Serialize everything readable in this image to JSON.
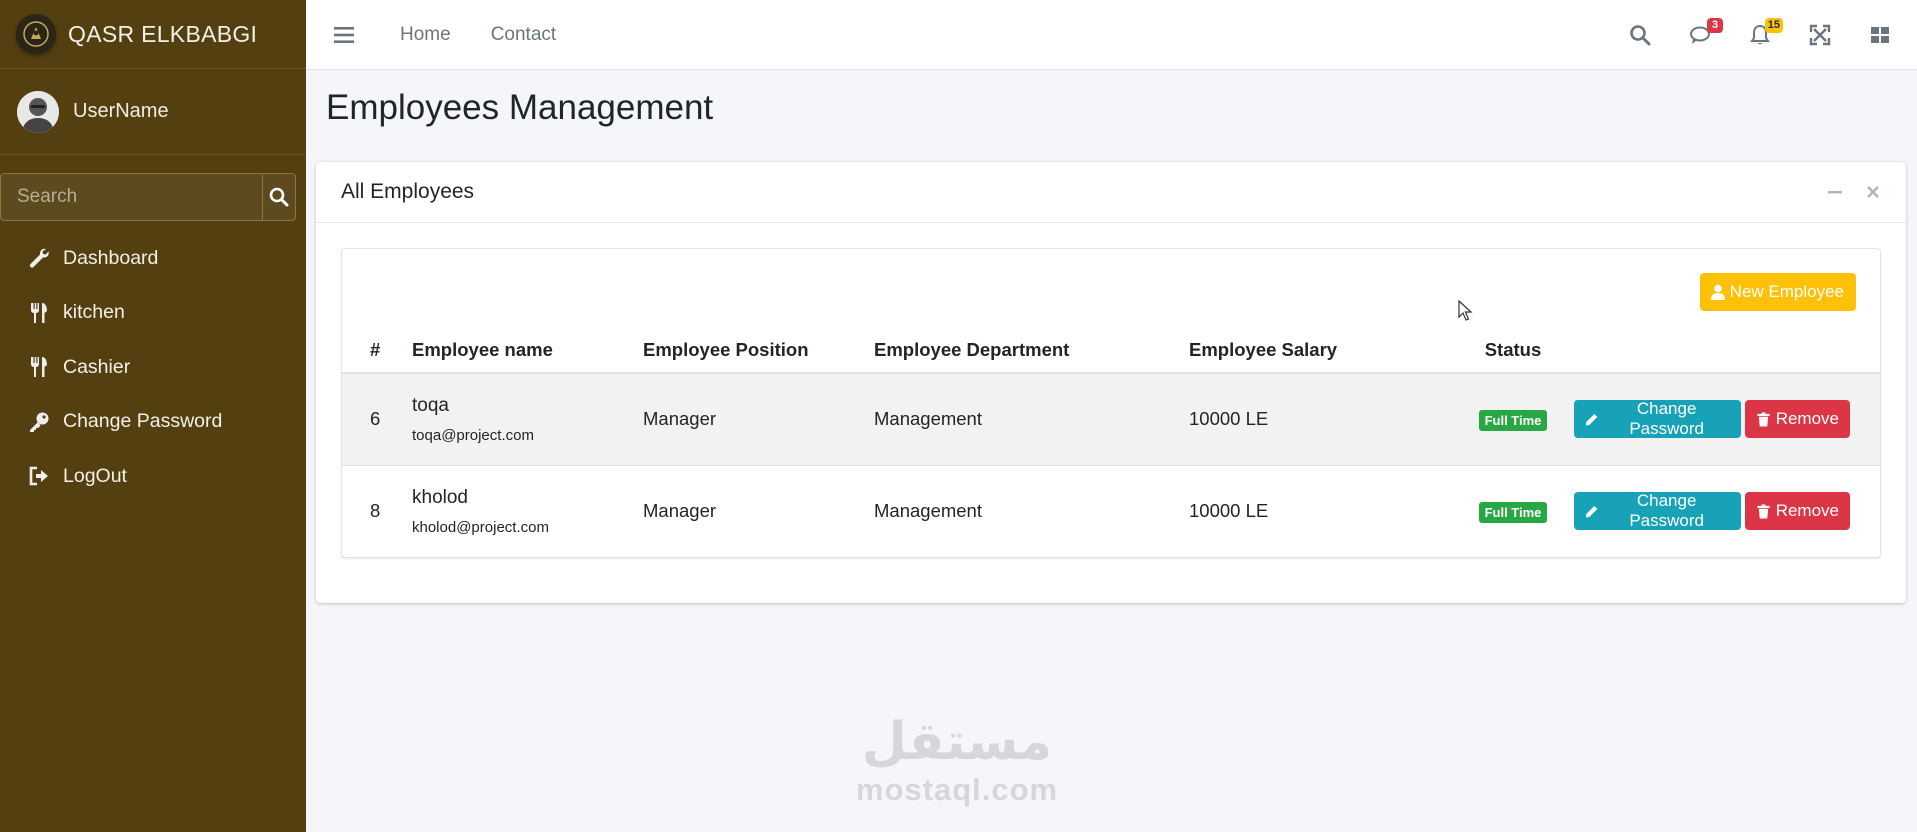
{
  "brand": {
    "name": "QASR ELKBABGI",
    "logo_icon": "crest-icon"
  },
  "user": {
    "name": "UserName"
  },
  "sidebar": {
    "search_placeholder": "Search",
    "items": [
      {
        "label": "Dashboard",
        "icon": "wrench-icon"
      },
      {
        "label": "kitchen",
        "icon": "utensils-icon"
      },
      {
        "label": "Cashier",
        "icon": "utensils-icon"
      },
      {
        "label": "Change Password",
        "icon": "key-icon"
      },
      {
        "label": "LogOut",
        "icon": "sign-out-icon"
      }
    ]
  },
  "topbar": {
    "links": [
      "Home",
      "Contact"
    ],
    "messages_count": "3",
    "notifications_count": "15"
  },
  "page": {
    "title": "Employees Management"
  },
  "card": {
    "title": "All Employees",
    "new_button": "New Employee",
    "columns": [
      "#",
      "Employee name",
      "Employee Position",
      "Employee Department",
      "Employee Salary",
      "Status"
    ],
    "rows": [
      {
        "id": "6",
        "name": "toqa",
        "email": "toqa@project.com",
        "position": "Manager",
        "department": "Management",
        "salary": "10000 LE",
        "status": "Full Time",
        "change_password": "Change Password",
        "remove": "Remove"
      },
      {
        "id": "8",
        "name": "kholod",
        "email": "kholod@project.com",
        "position": "Manager",
        "department": "Management",
        "salary": "10000 LE",
        "status": "Full Time",
        "change_password": "Change Password",
        "remove": "Remove"
      }
    ]
  },
  "watermark": {
    "arabic": "مستقل",
    "latin": "mostaql.com"
  },
  "colors": {
    "sidebar": "#533f10",
    "warning": "#ffc107",
    "info": "#17a2b8",
    "danger": "#dc3545",
    "success": "#28a745"
  }
}
